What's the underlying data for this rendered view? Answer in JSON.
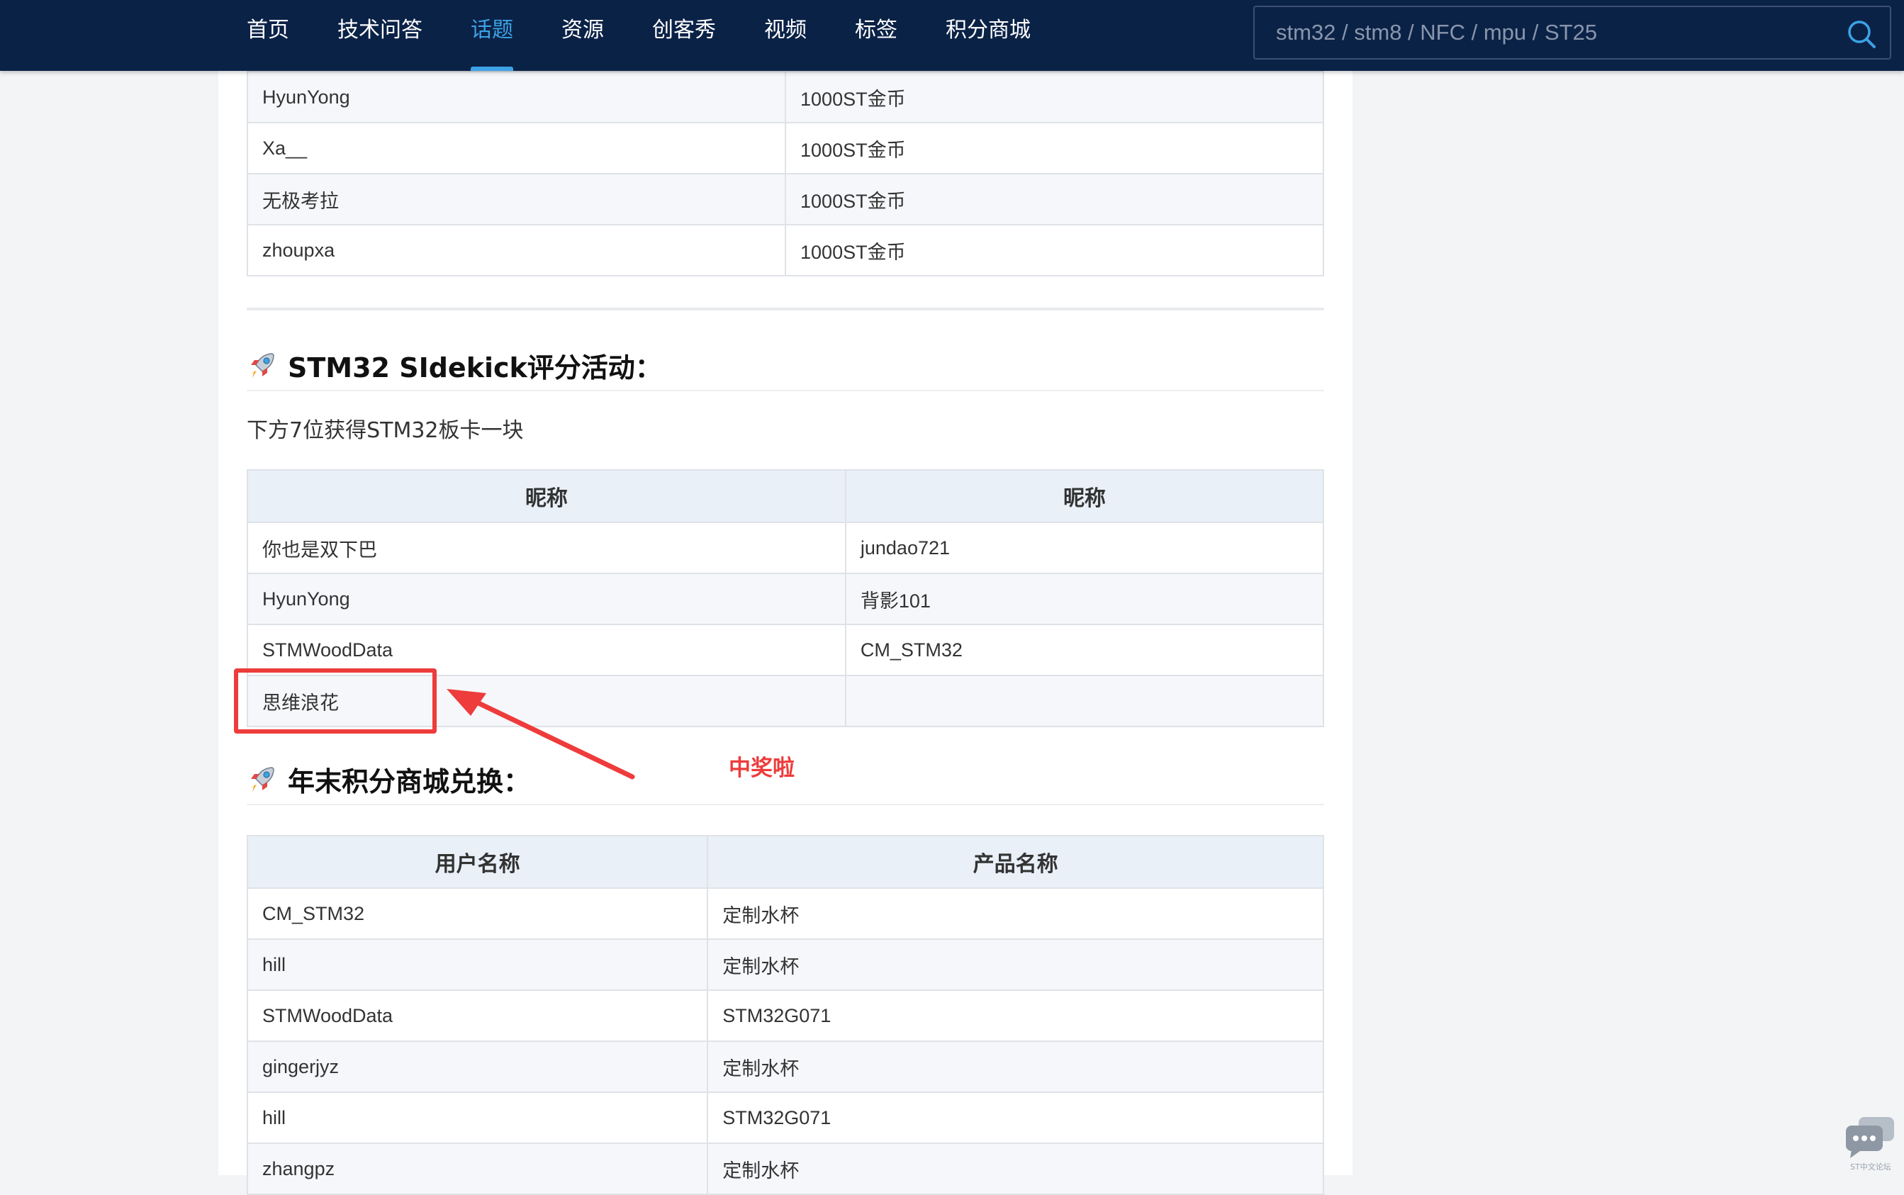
{
  "nav": {
    "items": [
      "首页",
      "技术问答",
      "话题",
      "资源",
      "创客秀",
      "视频",
      "标签",
      "积分商城"
    ],
    "active_index": 2,
    "active_color": "#3ca3e6",
    "background": "#0b2247"
  },
  "search": {
    "placeholder": "stm32 / stm8 / NFC / mpu / ST25",
    "icon": "search-icon"
  },
  "table1": {
    "rows": [
      [
        "HyunYong",
        "1000ST金币"
      ],
      [
        "Xa__",
        "1000ST金币"
      ],
      [
        "无极考拉",
        "1000ST金币"
      ],
      [
        "zhoupxa",
        "1000ST金币"
      ]
    ]
  },
  "section2": {
    "title": "STM32 SIdekick评分活动：",
    "icon": "rocket-icon",
    "subtitle": "下方7位获得STM32板卡一块",
    "headers": [
      "昵称",
      "昵称"
    ],
    "rows": [
      [
        "你也是双下巴",
        "jundao721"
      ],
      [
        "HyunYong",
        "背影101"
      ],
      [
        "STMWoodData",
        "CM_STM32"
      ],
      [
        "思维浪花",
        ""
      ]
    ]
  },
  "annotation": {
    "text": "中奖啦",
    "color": "#ee3b3b"
  },
  "section3": {
    "title": "年末积分商城兑换：",
    "icon": "rocket-icon",
    "headers": [
      "用户名称",
      "产品名称"
    ],
    "rows": [
      [
        "CM_STM32",
        "定制水杯"
      ],
      [
        "hill",
        "定制水杯"
      ],
      [
        "STMWoodData",
        "STM32G071"
      ],
      [
        "gingerjyz",
        "定制水杯"
      ],
      [
        "hill",
        "STM32G071"
      ],
      [
        "zhangpz",
        "定制水杯"
      ]
    ]
  },
  "chat": {
    "icon": "chat-bubble-icon",
    "label": "ST中文论坛"
  }
}
